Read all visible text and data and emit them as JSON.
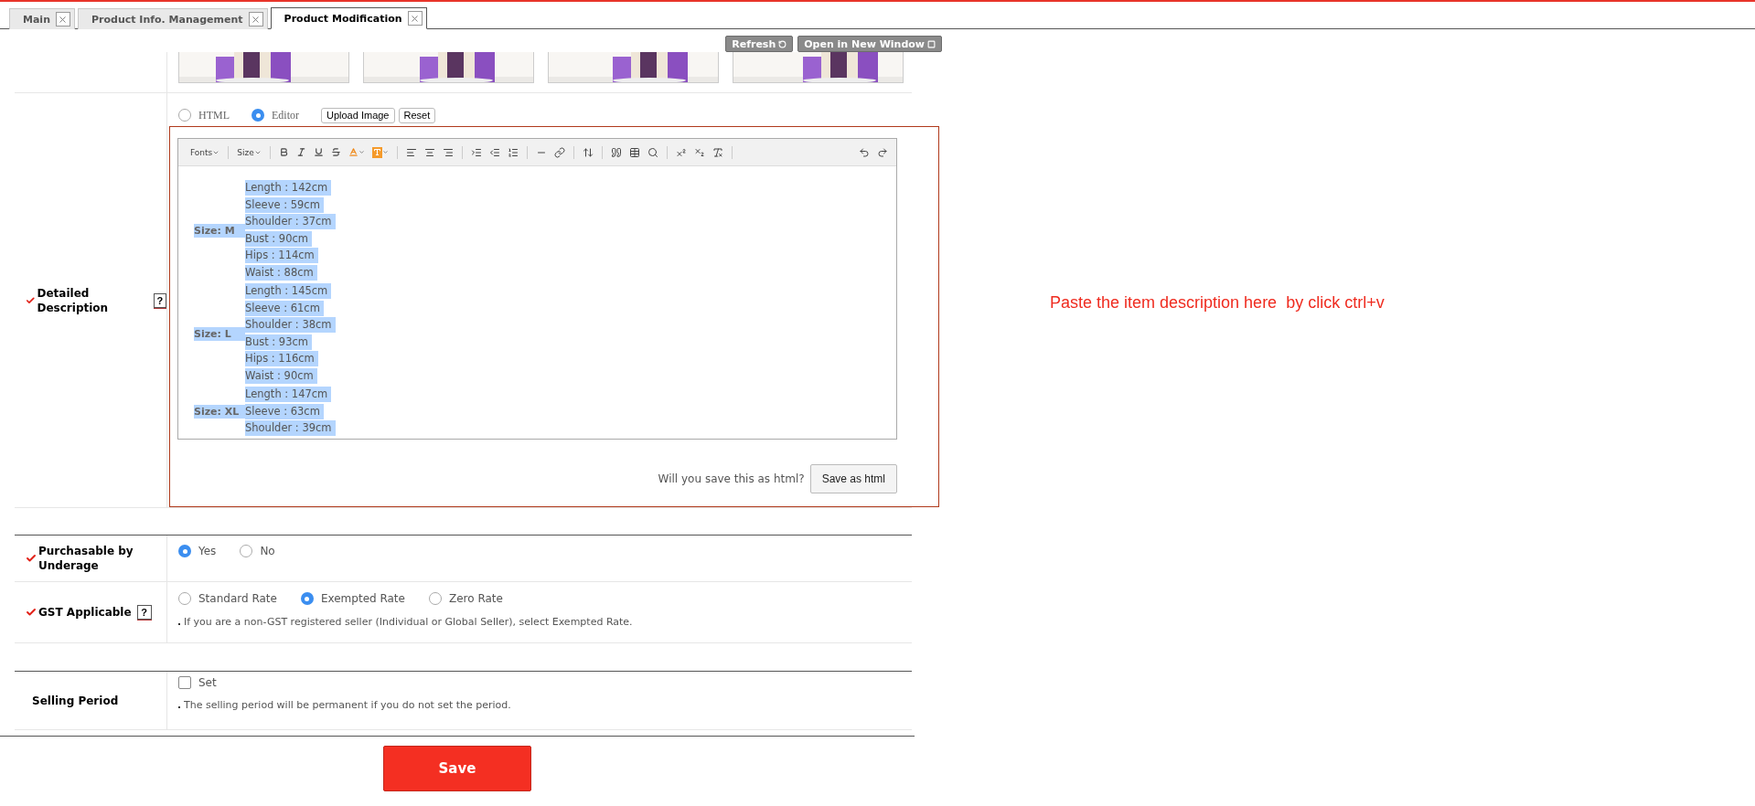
{
  "tabs": [
    {
      "label": "Main",
      "selected": false
    },
    {
      "label": "Product Info. Management",
      "selected": false
    },
    {
      "label": "Product Modification",
      "selected": true
    }
  ],
  "header_buttons": [
    {
      "label": "Refresh",
      "kind": "refresh"
    },
    {
      "label": "Open in New Window",
      "kind": "window"
    }
  ],
  "description": {
    "label": "Detailed Description",
    "required": true,
    "help": "?",
    "modes": [
      {
        "label": "HTML",
        "selected": false
      },
      {
        "label": "Editor",
        "selected": true
      }
    ],
    "buttons": [
      "Upload Image",
      "Reset"
    ],
    "toolbar_menus": [
      "Fonts",
      "Size"
    ],
    "content": [
      {
        "size": "Size: M",
        "lines": [
          "Length : 142cm",
          "Sleeve : 59cm",
          "Shoulder : 37cm",
          "Bust : 90cm",
          "Hips : 114cm",
          "Waist : 88cm"
        ]
      },
      {
        "size": "Size: L",
        "lines": [
          "Length : 145cm",
          "Sleeve : 61cm",
          "Shoulder : 38cm",
          "Bust : 93cm",
          "Hips : 116cm",
          "Waist : 90cm"
        ]
      },
      {
        "size": "Size: XL",
        "lines": [
          "Length : 147cm",
          "Sleeve : 63cm",
          "Shoulder : 39cm"
        ]
      }
    ],
    "save_prompt": "Will you save this as html?",
    "save_html_button": "Save as html"
  },
  "hint": "Paste the item description here  by click ctrl+v",
  "purchasable": {
    "label": "Purchasable by Underage",
    "required": true,
    "options": [
      {
        "label": "Yes",
        "selected": true
      },
      {
        "label": "No",
        "selected": false
      }
    ]
  },
  "gst": {
    "label": "GST Applicable",
    "required": true,
    "help": "?",
    "options": [
      {
        "label": "Standard Rate",
        "selected": false
      },
      {
        "label": "Exempted Rate",
        "selected": true
      },
      {
        "label": "Zero Rate",
        "selected": false
      }
    ],
    "note": "If you are a non-GST registered seller (Individual or Global Seller), select Exempted Rate."
  },
  "selling_period": {
    "label": "Selling Period",
    "option": {
      "label": "Set",
      "checked": false
    },
    "note": "The selling period will be permanent if you do not set the period."
  },
  "save_button": "Save"
}
